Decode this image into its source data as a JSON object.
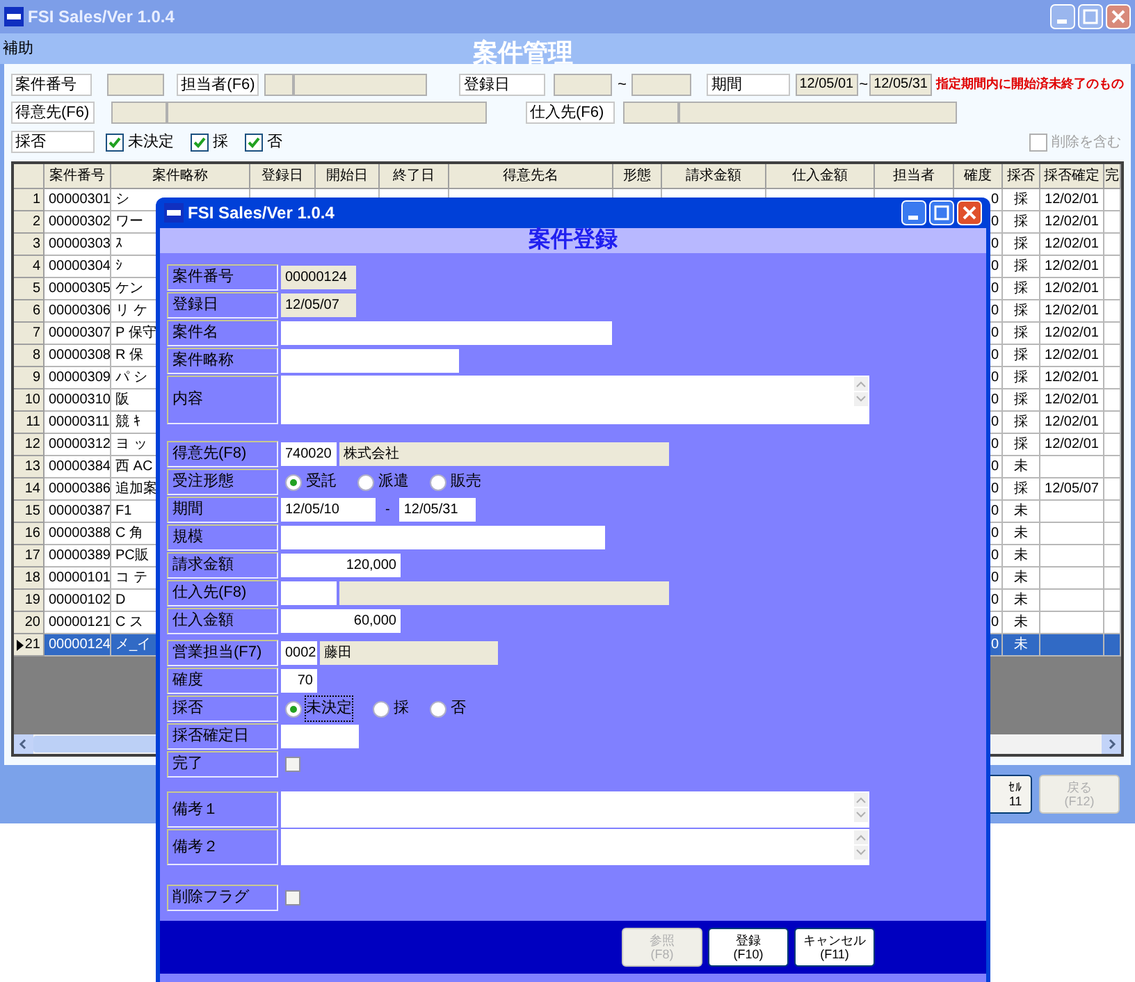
{
  "window": {
    "title": "FSI Sales/Ver 1.0.4",
    "menu": [
      "補助"
    ],
    "heading": "案件管理"
  },
  "filters": {
    "case_no": {
      "label": "案件番号"
    },
    "staff": {
      "label": "担当者(F6)"
    },
    "reg_date": {
      "label": "登録日",
      "separator": "~"
    },
    "period": {
      "label": "期間",
      "from": "12/05/01",
      "separator": "~",
      "to": "12/05/31",
      "note": "指定期間内に開始済未終了のもの"
    },
    "customer": {
      "label": "得意先(F6)"
    },
    "supplier": {
      "label": "仕入先(F6)"
    },
    "adoption": {
      "label": "採否",
      "options": [
        {
          "label": "未決定",
          "checked": true
        },
        {
          "label": "採",
          "checked": true
        },
        {
          "label": "否",
          "checked": true
        }
      ]
    },
    "include_deleted": {
      "label": "削除を含む",
      "checked": false
    }
  },
  "grid": {
    "columns": [
      "案件番号",
      "案件略称",
      "登録日",
      "開始日",
      "終了日",
      "得意先名",
      "形態",
      "請求金額",
      "仕入金額",
      "担当者",
      "確度",
      "採否",
      "採否確定",
      "完"
    ],
    "rows": [
      {
        "no": "1",
        "id": "00000301",
        "short_name": "シ",
        "certainty": "0",
        "adoption": "採",
        "decided": "12/02/01",
        "selected": false
      },
      {
        "no": "2",
        "id": "00000302",
        "short_name": "ワー",
        "certainty": "0",
        "adoption": "採",
        "decided": "12/02/01",
        "selected": false
      },
      {
        "no": "3",
        "id": "00000303",
        "short_name": "ｽ",
        "certainty": "0",
        "adoption": "採",
        "decided": "12/02/01",
        "selected": false
      },
      {
        "no": "4",
        "id": "00000304",
        "short_name": "ｼ",
        "certainty": "0",
        "adoption": "採",
        "decided": "12/02/01",
        "selected": false
      },
      {
        "no": "5",
        "id": "00000305",
        "short_name": "ケン",
        "certainty": "0",
        "adoption": "採",
        "decided": "12/02/01",
        "selected": false
      },
      {
        "no": "6",
        "id": "00000306",
        "short_name": "リ ケ",
        "certainty": "0",
        "adoption": "採",
        "decided": "12/02/01",
        "selected": false
      },
      {
        "no": "7",
        "id": "00000307",
        "short_name": "P 保守",
        "certainty": "0",
        "adoption": "採",
        "decided": "12/02/01",
        "selected": false
      },
      {
        "no": "8",
        "id": "00000308",
        "short_name": "R 保",
        "certainty": "0",
        "adoption": "採",
        "decided": "12/02/01",
        "selected": false
      },
      {
        "no": "9",
        "id": "00000309",
        "short_name": "パ シ",
        "certainty": "0",
        "adoption": "採",
        "decided": "12/02/01",
        "selected": false
      },
      {
        "no": "10",
        "id": "00000310",
        "short_name": "阪",
        "certainty": "0",
        "adoption": "採",
        "decided": "12/02/01",
        "selected": false
      },
      {
        "no": "11",
        "id": "00000311",
        "short_name": "競 ｷ",
        "certainty": "0",
        "adoption": "採",
        "decided": "12/02/01",
        "selected": false
      },
      {
        "no": "12",
        "id": "00000312",
        "short_name": "ヨ ッ",
        "certainty": "0",
        "adoption": "採",
        "decided": "12/02/01",
        "selected": false
      },
      {
        "no": "13",
        "id": "00000384",
        "short_name": "西 AC",
        "certainty": "0",
        "adoption": "未",
        "selected": false
      },
      {
        "no": "14",
        "id": "00000386",
        "short_name": "追加案",
        "certainty": "0",
        "adoption": "採",
        "decided": "12/05/07",
        "selected": false
      },
      {
        "no": "15",
        "id": "00000387",
        "short_name": "F1",
        "certainty": "0",
        "adoption": "未",
        "selected": false
      },
      {
        "no": "16",
        "id": "00000388",
        "short_name": "C 角",
        "certainty": "0",
        "adoption": "未",
        "selected": false
      },
      {
        "no": "17",
        "id": "00000389",
        "short_name": "PC販",
        "certainty": "0",
        "adoption": "未",
        "selected": false
      },
      {
        "no": "18",
        "id": "00000101",
        "short_name": "コ テ",
        "certainty": "0",
        "adoption": "未",
        "selected": false
      },
      {
        "no": "19",
        "id": "00000102",
        "short_name": "D",
        "certainty": "0",
        "adoption": "未",
        "selected": false
      },
      {
        "no": "20",
        "id": "00000121",
        "short_name": "C ス",
        "certainty": "0",
        "adoption": "未",
        "selected": false
      },
      {
        "no": "21",
        "id": "00000124",
        "short_name": "メ_イ",
        "certainty": "0",
        "adoption": "未",
        "selected": true
      }
    ]
  },
  "buttons": [
    {
      "lines": [
        "ｾﾙ",
        "11"
      ],
      "disabled": false
    },
    {
      "lines": [
        "戻る",
        "(F12)"
      ],
      "disabled": true
    }
  ],
  "dialog": {
    "title": "FSI Sales/Ver 1.0.4",
    "heading": "案件登録",
    "sections": [
      [
        {
          "kind": "readonly",
          "label": "案件番号",
          "value": "00000124"
        },
        {
          "kind": "readonly",
          "label": "登録日",
          "value": "12/05/07"
        },
        {
          "kind": "text",
          "label": "案件名"
        },
        {
          "kind": "text",
          "label": "案件略称"
        },
        {
          "kind": "textarea",
          "label": "内容"
        }
      ],
      [
        {
          "kind": "lookup",
          "label": "得意先(F8)",
          "code": "740020",
          "name": "株式会社"
        },
        {
          "kind": "radio",
          "label": "受注形態",
          "options": [
            {
              "label": "受託",
              "selected": true
            },
            {
              "label": "派遣",
              "selected": false
            },
            {
              "label": "販売",
              "selected": false
            }
          ]
        },
        {
          "kind": "range",
          "label": "期間",
          "from": "12/05/10",
          "separator": "-",
          "to": "12/05/31"
        },
        {
          "kind": "text",
          "label": "規模"
        },
        {
          "kind": "amount",
          "label": "請求金額",
          "value": "120,000"
        },
        {
          "kind": "lookup",
          "label": "仕入先(F8)"
        },
        {
          "kind": "amount",
          "label": "仕入金額",
          "value": "60,000"
        }
      ],
      [
        {
          "kind": "lookup",
          "label": "営業担当(F7)",
          "code": "0002",
          "name": "藤田"
        },
        {
          "kind": "amount",
          "label": "確度",
          "value": "70"
        },
        {
          "kind": "radio",
          "label": "採否",
          "options": [
            {
              "label": "未決定",
              "selected": true
            },
            {
              "label": "採",
              "selected": false
            },
            {
              "label": "否",
              "selected": false
            }
          ]
        },
        {
          "kind": "text",
          "label": "採否確定日"
        },
        {
          "kind": "checkbox",
          "label": "完了",
          "checked": false
        }
      ],
      [
        {
          "kind": "textarea",
          "label": "備考１"
        },
        {
          "kind": "textarea",
          "label": "備考２"
        }
      ],
      [
        {
          "kind": "checkbox",
          "label": "削除フラグ",
          "checked": false
        }
      ]
    ],
    "buttons": [
      {
        "label": "参照",
        "key": "(F8)",
        "disabled": true
      },
      {
        "label": "登録",
        "key": "(F10)",
        "disabled": false
      },
      {
        "label": "キャンセル",
        "key": "(F11)",
        "disabled": false
      }
    ]
  }
}
